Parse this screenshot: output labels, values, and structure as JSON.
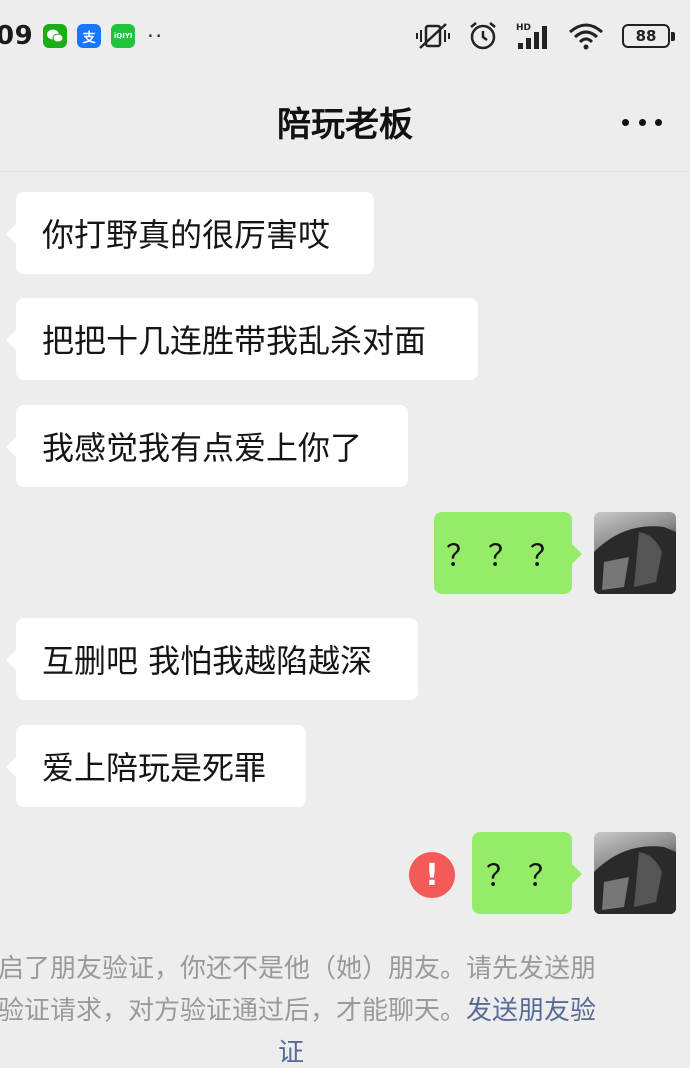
{
  "status_bar": {
    "time": "09",
    "apps": [
      "wechat-icon",
      "alipay-icon",
      "iqiyi-icon"
    ],
    "iqiyi_label": "iQIYI",
    "alipay_label": "支",
    "dots": "··",
    "battery": "88"
  },
  "header": {
    "title": "陪玩老板",
    "more_label": "···"
  },
  "messages": [
    {
      "side": "left",
      "text": "你打野真的很厉害哎"
    },
    {
      "side": "left",
      "text": "把把十几连胜带我乱杀对面"
    },
    {
      "side": "left",
      "text": "我感觉我有点爱上你了"
    },
    {
      "side": "right",
      "text": "？？？"
    },
    {
      "side": "left",
      "text": "互删吧 我怕我越陷越深"
    },
    {
      "side": "left",
      "text": "爱上陪玩是死罪"
    },
    {
      "side": "right",
      "text": "？？",
      "failed": true
    }
  ],
  "error_icon_text": "!",
  "system_note": {
    "line1": "启了朋友验证，你还不是他（她）朋友。请先发送朋",
    "line2": "验证请求，对方验证通过后，才能聊天。",
    "link": "发送朋友验",
    "line3": "证"
  },
  "colors": {
    "background": "#ededed",
    "left_bubble": "#ffffff",
    "right_bubble": "#95ec69",
    "error": "#f35a5a",
    "link": "#576b95"
  }
}
